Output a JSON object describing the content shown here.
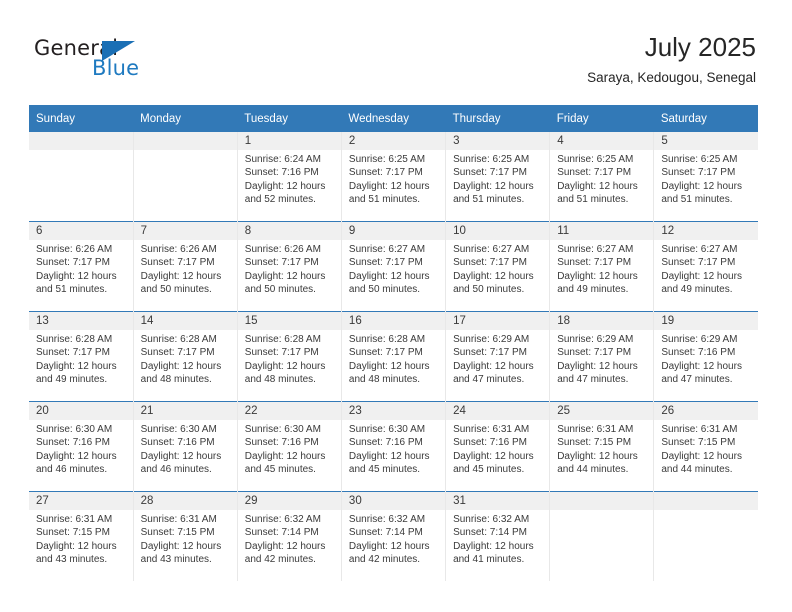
{
  "brand": {
    "name_part1": "General",
    "name_part2": "Blue",
    "triangle_icon": "triangle-icon"
  },
  "header": {
    "title": "July 2025",
    "location": "Saraya, Kedougou, Senegal"
  },
  "colors": {
    "header_blue": "#3279b7",
    "brand_blue": "#1f7ac0",
    "daynum_band": "#f0f0f0",
    "text": "#3a3a3a"
  },
  "weekday_headers": [
    "Sunday",
    "Monday",
    "Tuesday",
    "Wednesday",
    "Thursday",
    "Friday",
    "Saturday"
  ],
  "weeks": [
    [
      {
        "day": "",
        "sunrise": "",
        "sunset": "",
        "daylight_line1": "",
        "daylight_line2": ""
      },
      {
        "day": "",
        "sunrise": "",
        "sunset": "",
        "daylight_line1": "",
        "daylight_line2": ""
      },
      {
        "day": "1",
        "sunrise": "Sunrise: 6:24 AM",
        "sunset": "Sunset: 7:16 PM",
        "daylight_line1": "Daylight: 12 hours",
        "daylight_line2": "and 52 minutes."
      },
      {
        "day": "2",
        "sunrise": "Sunrise: 6:25 AM",
        "sunset": "Sunset: 7:17 PM",
        "daylight_line1": "Daylight: 12 hours",
        "daylight_line2": "and 51 minutes."
      },
      {
        "day": "3",
        "sunrise": "Sunrise: 6:25 AM",
        "sunset": "Sunset: 7:17 PM",
        "daylight_line1": "Daylight: 12 hours",
        "daylight_line2": "and 51 minutes."
      },
      {
        "day": "4",
        "sunrise": "Sunrise: 6:25 AM",
        "sunset": "Sunset: 7:17 PM",
        "daylight_line1": "Daylight: 12 hours",
        "daylight_line2": "and 51 minutes."
      },
      {
        "day": "5",
        "sunrise": "Sunrise: 6:25 AM",
        "sunset": "Sunset: 7:17 PM",
        "daylight_line1": "Daylight: 12 hours",
        "daylight_line2": "and 51 minutes."
      }
    ],
    [
      {
        "day": "6",
        "sunrise": "Sunrise: 6:26 AM",
        "sunset": "Sunset: 7:17 PM",
        "daylight_line1": "Daylight: 12 hours",
        "daylight_line2": "and 51 minutes."
      },
      {
        "day": "7",
        "sunrise": "Sunrise: 6:26 AM",
        "sunset": "Sunset: 7:17 PM",
        "daylight_line1": "Daylight: 12 hours",
        "daylight_line2": "and 50 minutes."
      },
      {
        "day": "8",
        "sunrise": "Sunrise: 6:26 AM",
        "sunset": "Sunset: 7:17 PM",
        "daylight_line1": "Daylight: 12 hours",
        "daylight_line2": "and 50 minutes."
      },
      {
        "day": "9",
        "sunrise": "Sunrise: 6:27 AM",
        "sunset": "Sunset: 7:17 PM",
        "daylight_line1": "Daylight: 12 hours",
        "daylight_line2": "and 50 minutes."
      },
      {
        "day": "10",
        "sunrise": "Sunrise: 6:27 AM",
        "sunset": "Sunset: 7:17 PM",
        "daylight_line1": "Daylight: 12 hours",
        "daylight_line2": "and 50 minutes."
      },
      {
        "day": "11",
        "sunrise": "Sunrise: 6:27 AM",
        "sunset": "Sunset: 7:17 PM",
        "daylight_line1": "Daylight: 12 hours",
        "daylight_line2": "and 49 minutes."
      },
      {
        "day": "12",
        "sunrise": "Sunrise: 6:27 AM",
        "sunset": "Sunset: 7:17 PM",
        "daylight_line1": "Daylight: 12 hours",
        "daylight_line2": "and 49 minutes."
      }
    ],
    [
      {
        "day": "13",
        "sunrise": "Sunrise: 6:28 AM",
        "sunset": "Sunset: 7:17 PM",
        "daylight_line1": "Daylight: 12 hours",
        "daylight_line2": "and 49 minutes."
      },
      {
        "day": "14",
        "sunrise": "Sunrise: 6:28 AM",
        "sunset": "Sunset: 7:17 PM",
        "daylight_line1": "Daylight: 12 hours",
        "daylight_line2": "and 48 minutes."
      },
      {
        "day": "15",
        "sunrise": "Sunrise: 6:28 AM",
        "sunset": "Sunset: 7:17 PM",
        "daylight_line1": "Daylight: 12 hours",
        "daylight_line2": "and 48 minutes."
      },
      {
        "day": "16",
        "sunrise": "Sunrise: 6:28 AM",
        "sunset": "Sunset: 7:17 PM",
        "daylight_line1": "Daylight: 12 hours",
        "daylight_line2": "and 48 minutes."
      },
      {
        "day": "17",
        "sunrise": "Sunrise: 6:29 AM",
        "sunset": "Sunset: 7:17 PM",
        "daylight_line1": "Daylight: 12 hours",
        "daylight_line2": "and 47 minutes."
      },
      {
        "day": "18",
        "sunrise": "Sunrise: 6:29 AM",
        "sunset": "Sunset: 7:17 PM",
        "daylight_line1": "Daylight: 12 hours",
        "daylight_line2": "and 47 minutes."
      },
      {
        "day": "19",
        "sunrise": "Sunrise: 6:29 AM",
        "sunset": "Sunset: 7:16 PM",
        "daylight_line1": "Daylight: 12 hours",
        "daylight_line2": "and 47 minutes."
      }
    ],
    [
      {
        "day": "20",
        "sunrise": "Sunrise: 6:30 AM",
        "sunset": "Sunset: 7:16 PM",
        "daylight_line1": "Daylight: 12 hours",
        "daylight_line2": "and 46 minutes."
      },
      {
        "day": "21",
        "sunrise": "Sunrise: 6:30 AM",
        "sunset": "Sunset: 7:16 PM",
        "daylight_line1": "Daylight: 12 hours",
        "daylight_line2": "and 46 minutes."
      },
      {
        "day": "22",
        "sunrise": "Sunrise: 6:30 AM",
        "sunset": "Sunset: 7:16 PM",
        "daylight_line1": "Daylight: 12 hours",
        "daylight_line2": "and 45 minutes."
      },
      {
        "day": "23",
        "sunrise": "Sunrise: 6:30 AM",
        "sunset": "Sunset: 7:16 PM",
        "daylight_line1": "Daylight: 12 hours",
        "daylight_line2": "and 45 minutes."
      },
      {
        "day": "24",
        "sunrise": "Sunrise: 6:31 AM",
        "sunset": "Sunset: 7:16 PM",
        "daylight_line1": "Daylight: 12 hours",
        "daylight_line2": "and 45 minutes."
      },
      {
        "day": "25",
        "sunrise": "Sunrise: 6:31 AM",
        "sunset": "Sunset: 7:15 PM",
        "daylight_line1": "Daylight: 12 hours",
        "daylight_line2": "and 44 minutes."
      },
      {
        "day": "26",
        "sunrise": "Sunrise: 6:31 AM",
        "sunset": "Sunset: 7:15 PM",
        "daylight_line1": "Daylight: 12 hours",
        "daylight_line2": "and 44 minutes."
      }
    ],
    [
      {
        "day": "27",
        "sunrise": "Sunrise: 6:31 AM",
        "sunset": "Sunset: 7:15 PM",
        "daylight_line1": "Daylight: 12 hours",
        "daylight_line2": "and 43 minutes."
      },
      {
        "day": "28",
        "sunrise": "Sunrise: 6:31 AM",
        "sunset": "Sunset: 7:15 PM",
        "daylight_line1": "Daylight: 12 hours",
        "daylight_line2": "and 43 minutes."
      },
      {
        "day": "29",
        "sunrise": "Sunrise: 6:32 AM",
        "sunset": "Sunset: 7:14 PM",
        "daylight_line1": "Daylight: 12 hours",
        "daylight_line2": "and 42 minutes."
      },
      {
        "day": "30",
        "sunrise": "Sunrise: 6:32 AM",
        "sunset": "Sunset: 7:14 PM",
        "daylight_line1": "Daylight: 12 hours",
        "daylight_line2": "and 42 minutes."
      },
      {
        "day": "31",
        "sunrise": "Sunrise: 6:32 AM",
        "sunset": "Sunset: 7:14 PM",
        "daylight_line1": "Daylight: 12 hours",
        "daylight_line2": "and 41 minutes."
      },
      {
        "day": "",
        "sunrise": "",
        "sunset": "",
        "daylight_line1": "",
        "daylight_line2": ""
      },
      {
        "day": "",
        "sunrise": "",
        "sunset": "",
        "daylight_line1": "",
        "daylight_line2": ""
      }
    ]
  ]
}
